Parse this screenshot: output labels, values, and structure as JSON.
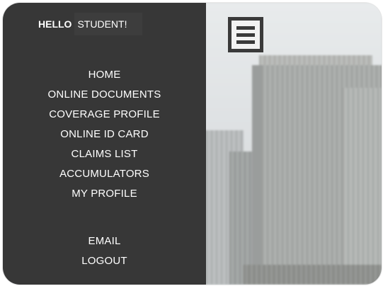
{
  "greeting": {
    "hello": "HELLO",
    "name": "STUDENT!"
  },
  "menu": {
    "items": [
      {
        "label": "HOME"
      },
      {
        "label": "ONLINE DOCUMENTS"
      },
      {
        "label": "COVERAGE PROFILE"
      },
      {
        "label": "ONLINE ID CARD"
      },
      {
        "label": "CLAIMS LIST"
      },
      {
        "label": "ACCUMULATORS"
      },
      {
        "label": "MY PROFILE"
      }
    ],
    "secondary": [
      {
        "label": "EMAIL"
      },
      {
        "label": "LOGOUT"
      }
    ]
  },
  "icons": {
    "menu_toggle": "hamburger-menu-icon"
  },
  "colors": {
    "sidebar_bg": "#373737",
    "text": "#ffffff",
    "icon": "#3a3a3a"
  }
}
